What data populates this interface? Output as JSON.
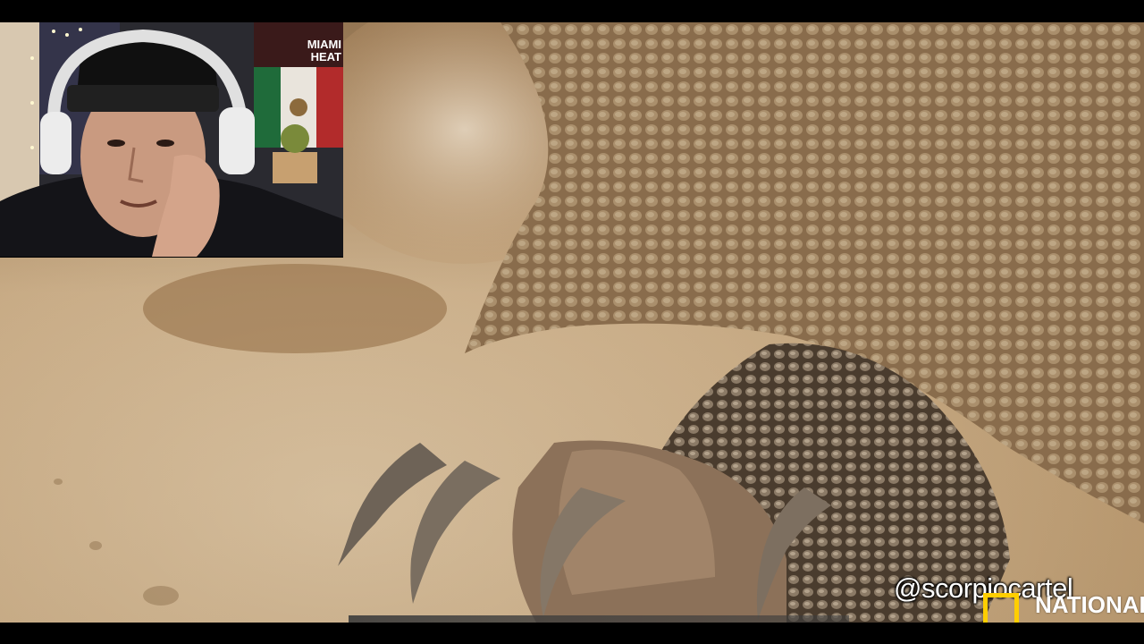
{
  "video": {
    "description_label": "",
    "watermark_handle": "@scorpiocartel",
    "channel_logo_text": "NATIONAL GEOGRAPHIC"
  },
  "webcam": {
    "poster_line1": "MIAMI",
    "poster_line2": "HEAT"
  },
  "colors": {
    "letterbox": "#000000",
    "sand": "#c9ad88",
    "scales": "#a88a66",
    "natgeo_yellow": "#ffce00",
    "watermark_text": "#ffffff"
  }
}
